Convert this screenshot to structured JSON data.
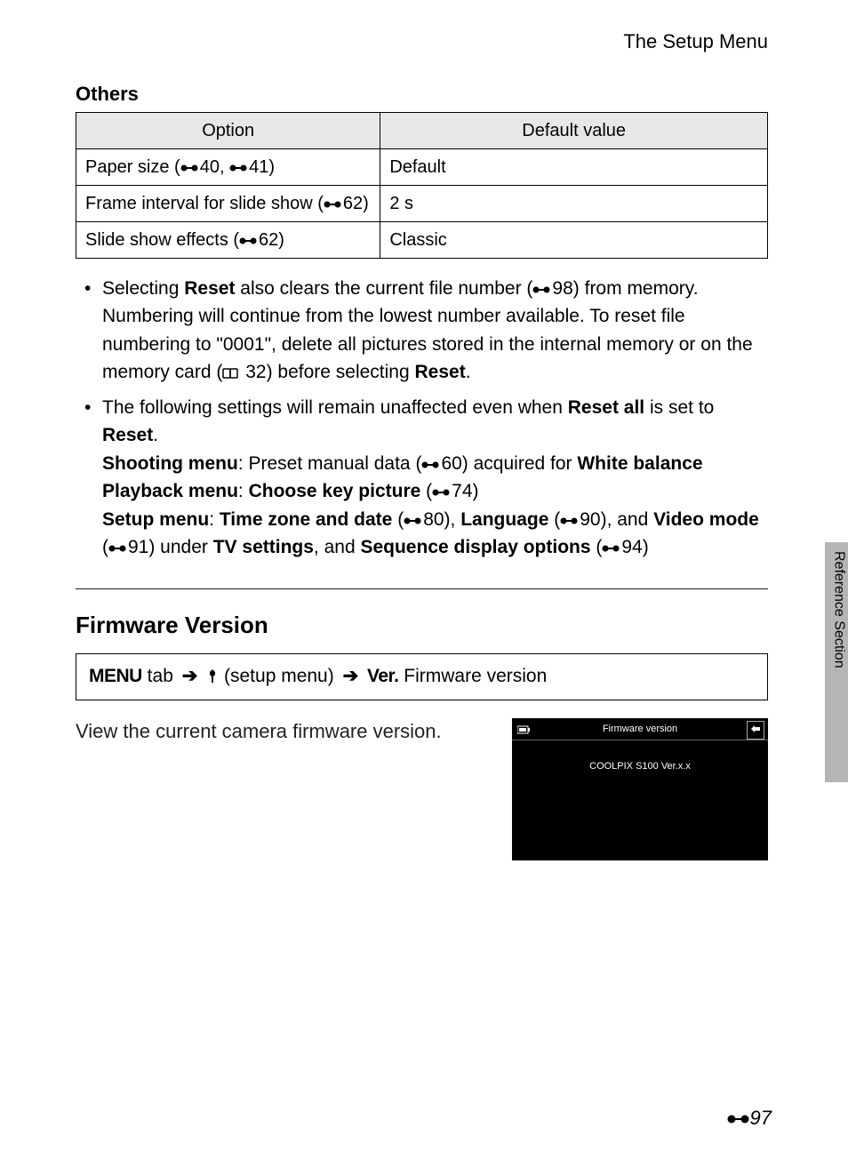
{
  "header": "The Setup Menu",
  "section_others": "Others",
  "table": {
    "head": [
      "Option",
      "Default value"
    ],
    "rows": [
      {
        "opt_a": "Paper size (",
        "ref1": "40",
        "mid": ", ",
        "ref2": "41",
        "opt_b": ")",
        "val": "Default"
      },
      {
        "opt_a": "Frame interval for slide show (",
        "ref1": "62",
        "opt_b": ")",
        "val": "2 s"
      },
      {
        "opt_a": "Slide show effects (",
        "ref1": "62",
        "opt_b": ")",
        "val": "Classic"
      }
    ]
  },
  "bullets": {
    "b1a": "Selecting ",
    "b1_reset": "Reset",
    "b1b": " also clears the current file number (",
    "b1_ref": "98",
    "b1c": ") from memory. Numbering will continue from the lowest number available. To reset file numbering to \"0001\", delete all pictures stored in the internal memory or on the memory card (",
    "b1_book": "32",
    "b1d": ") before selecting ",
    "b1_reset2": "Reset",
    "b1e": ".",
    "b2a": "The following settings will remain unaffected even when ",
    "b2_ra": "Reset all",
    "b2b": " is set to ",
    "b2_r": "Reset",
    "b2c": ".",
    "sm": "Shooting menu",
    "sm_t": ": Preset manual data (",
    "sm_ref": "60",
    "sm_t2": ") acquired for ",
    "wb": "White balance",
    "pm": "Playback menu",
    "pm_t": ": ",
    "ckp": "Choose key picture",
    "pm_ref": "74",
    "su": "Setup menu",
    "su_t": ": ",
    "tzd": "Time zone and date",
    "su_ref1": "80",
    "su_t2": "), ",
    "lang": "Language",
    "su_ref2": "90",
    "su_t3": "), and ",
    "vm": "Video mode",
    "su_ref3": "91",
    "su_t4": ") under ",
    "tvs": "TV settings",
    "su_t5": ", and ",
    "sdo": "Sequence display options",
    "su_ref4": "94",
    "su_t6": ")"
  },
  "fw_heading": "Firmware Version",
  "nav": {
    "menu": "MENU",
    "tab": " tab ",
    "setup": " (setup menu) ",
    "ver": "Ver.",
    "fw": " Firmware version"
  },
  "fw_text": "View the current camera firmware version.",
  "lcd": {
    "title": "Firmware version",
    "body": "COOLPIX S100 Ver.x.x"
  },
  "sidetab": "Reference Section",
  "pagenum": "97"
}
